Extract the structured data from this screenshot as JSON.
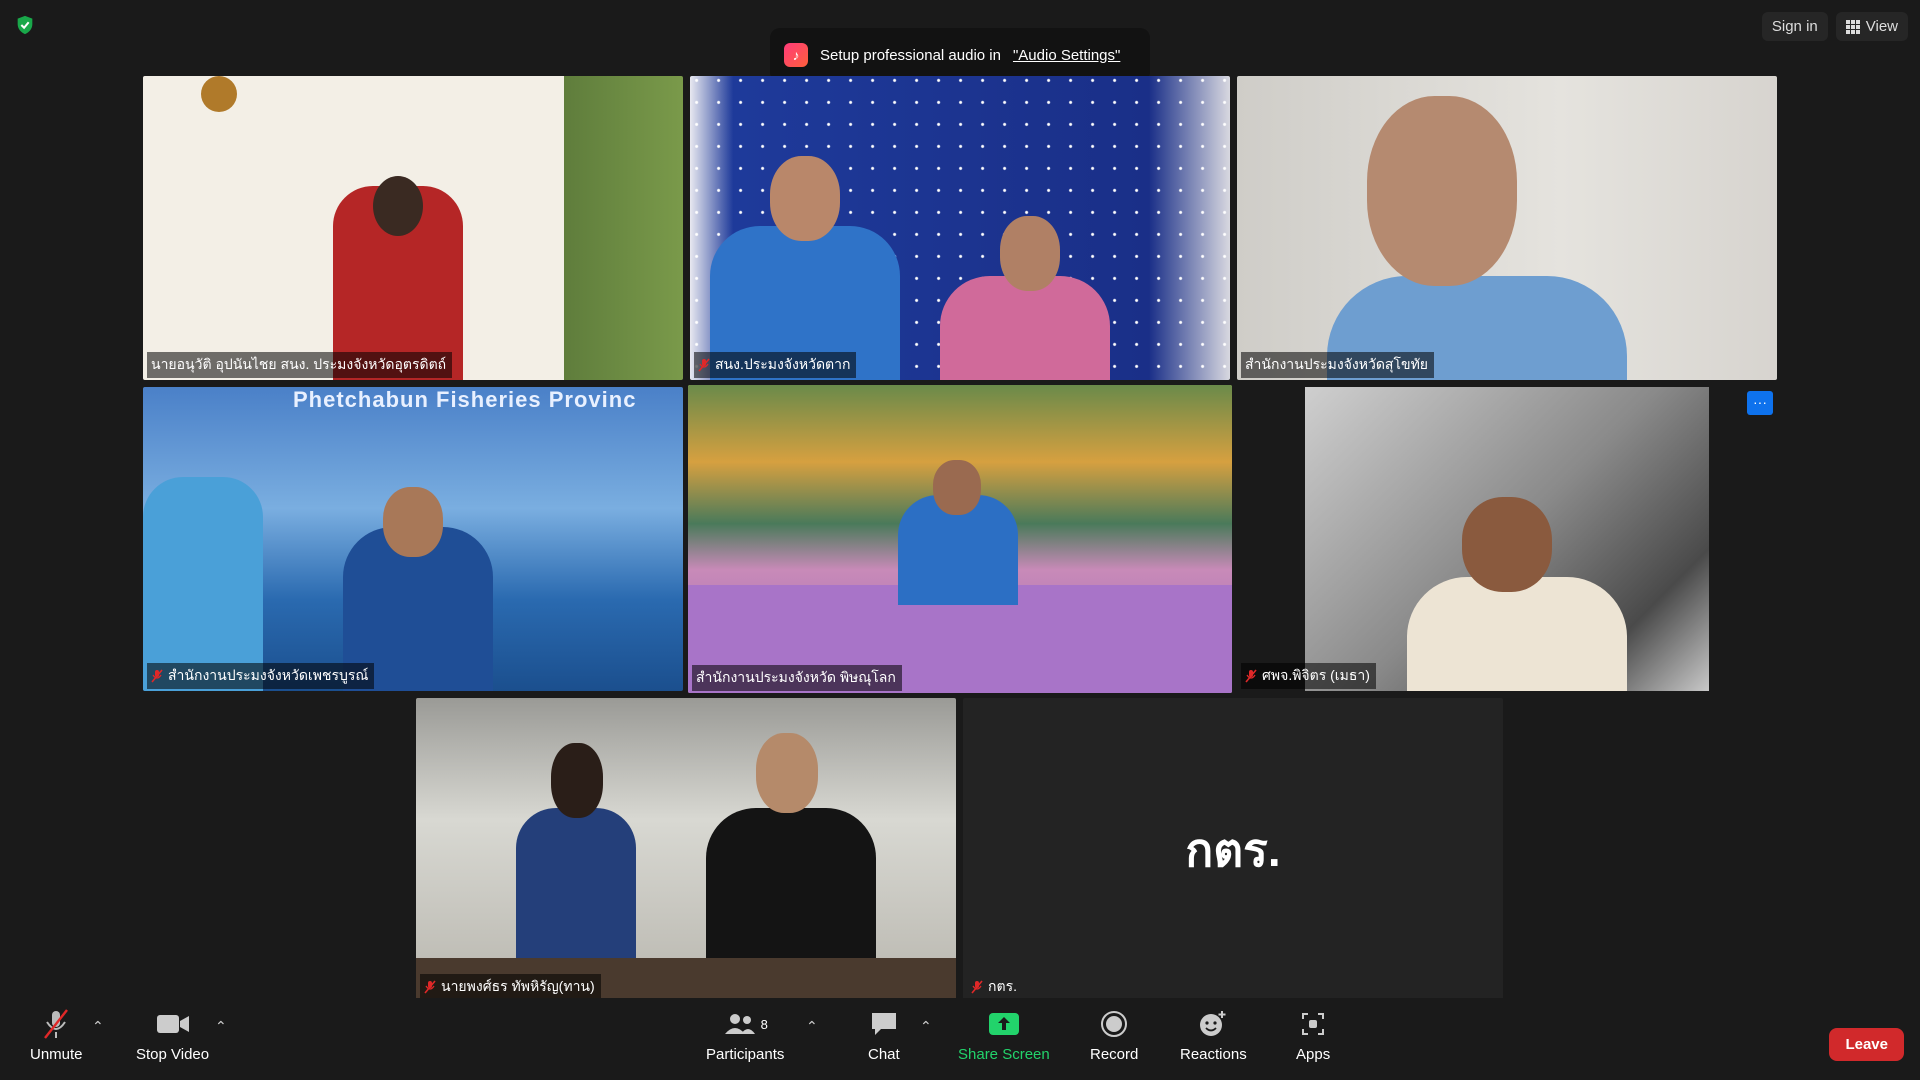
{
  "top": {
    "sign_in": "Sign in",
    "view": "View"
  },
  "banner": {
    "text": "Setup professional audio in",
    "link": "\"Audio Settings\""
  },
  "participants": [
    {
      "name": "นายอนุวัติ  อุปนันไชย สนง. ประมงจังหวัดอุตรดิตถ์"
    },
    {
      "name": "สนง.ประมงจังหวัดตาก"
    },
    {
      "name": "สำนักงานประมงจังหวัดสุโขทัย"
    },
    {
      "name": "สำนักงานประมงจังหวัดเพชรบูรณ์",
      "backdrop_text": "Phetchabun Fisheries Provinc"
    },
    {
      "name": "สำนักงานประมงจังหวัด พิษณุโลก"
    },
    {
      "name": "ศพจ.พิจิตร (เมธา)"
    },
    {
      "name": "นายพงศ์ธร ทัพหิรัญ(ทาน)"
    },
    {
      "name": "กตร.",
      "display": "กตร."
    }
  ],
  "toolbar": {
    "unmute": "Unmute",
    "stop_video": "Stop Video",
    "participants": "Participants",
    "participants_count": "8",
    "chat": "Chat",
    "share_screen": "Share Screen",
    "record": "Record",
    "reactions": "Reactions",
    "apps": "Apps",
    "leave": "Leave"
  },
  "colors": {
    "accent_green": "#22d36b",
    "leave_red": "#d1292b",
    "active_speaker": "#c9e46a",
    "mute_red": "#e02828"
  }
}
